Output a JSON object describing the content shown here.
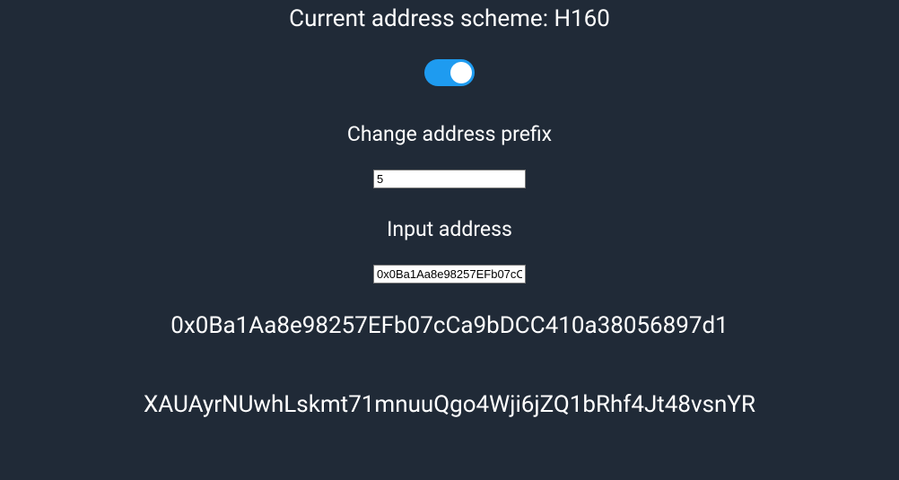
{
  "header": {
    "scheme_label": "Current address scheme: H160"
  },
  "toggle": {
    "state": "on"
  },
  "prefix_section": {
    "label": "Change address prefix",
    "value": "5"
  },
  "input_section": {
    "label": "Input address",
    "value": "0x0Ba1Aa8e98257EFb07cC"
  },
  "output": {
    "full_address": "0x0Ba1Aa8e98257EFb07cCa9bDCC410a38056897d1",
    "converted_address": "XAUAyrNUwhLskmt71mnuuQgo4Wji6jZQ1bRhf4Jt48vsnYR"
  }
}
